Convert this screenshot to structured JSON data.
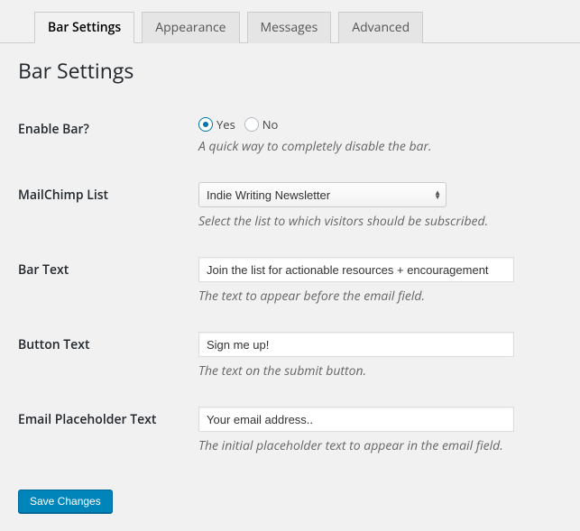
{
  "tabs": [
    {
      "label": "Bar Settings",
      "active": true
    },
    {
      "label": "Appearance",
      "active": false
    },
    {
      "label": "Messages",
      "active": false
    },
    {
      "label": "Advanced",
      "active": false
    }
  ],
  "page_title": "Bar Settings",
  "fields": {
    "enable_bar": {
      "label": "Enable Bar?",
      "yes": "Yes",
      "no": "No",
      "value": "yes",
      "description": "A quick way to completely disable the bar."
    },
    "mailchimp_list": {
      "label": "MailChimp List",
      "selected": "Indie Writing Newsletter",
      "description": "Select the list to which visitors should be subscribed."
    },
    "bar_text": {
      "label": "Bar Text",
      "value": "Join the list for actionable resources + encouragement",
      "description": "The text to appear before the email field."
    },
    "button_text": {
      "label": "Button Text",
      "value": "Sign me up!",
      "description": "The text on the submit button."
    },
    "email_placeholder": {
      "label": "Email Placeholder Text",
      "value": "Your email address..",
      "description": "The initial placeholder text to appear in the email field."
    }
  },
  "save_button": "Save Changes"
}
